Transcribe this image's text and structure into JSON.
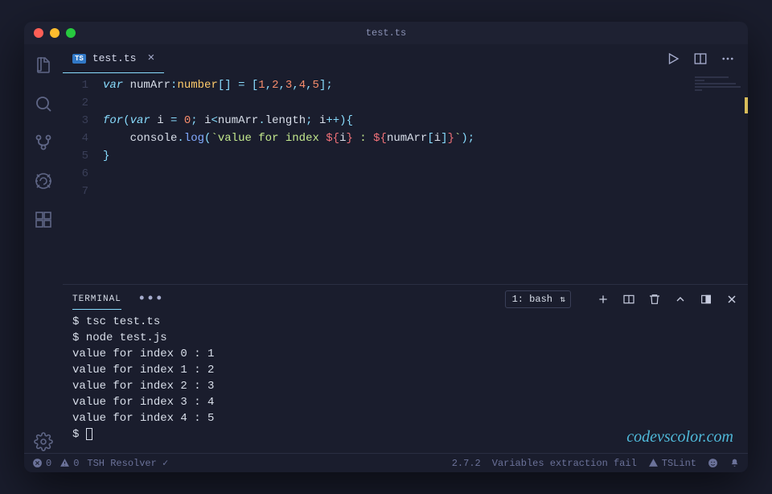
{
  "titlebar": {
    "title": "test.ts"
  },
  "tab": {
    "badge": "TS",
    "name": "test.ts",
    "close": "×"
  },
  "code": {
    "lines": [
      "1",
      "2",
      "3",
      "4",
      "5",
      "6",
      "7"
    ],
    "l1": {
      "var": "var ",
      "name": "numArr",
      "colon": ":",
      "type": "number",
      "brackets": "[] ",
      "eq": "= [",
      "n1": "1",
      "c1": ",",
      "n2": "2",
      "c2": ",",
      "n3": "3",
      "c3": ",",
      "n4": "4",
      "c4": ",",
      "n5": "5",
      "end": "];"
    },
    "l3": {
      "for": "for",
      "open": "(",
      "var": "var ",
      "i": "i",
      "eq": " = ",
      "zero": "0",
      "sc1": "; ",
      "cond_i": "i",
      "lt": "<",
      "arr": "numArr",
      "dot": ".",
      "len": "length",
      "sc2": "; ",
      "ipp": "i",
      "pp": "++",
      "close": "){"
    },
    "l4": {
      "indent": "    ",
      "console": "console",
      "dot": ".",
      "log": "log",
      "open": "(",
      "tick1": "`",
      "txt1": "value for index ",
      "d1": "${",
      "i": "i",
      "d1c": "}",
      "txt2": " : ",
      "d2": "${",
      "arr": "numArr",
      "b1": "[",
      "i2": "i",
      "b2": "]",
      "d2c": "}",
      "tick2": "`",
      "close": ");"
    },
    "l5": {
      "brace": "}"
    }
  },
  "panel": {
    "tab": "TERMINAL",
    "dots": "•••",
    "select": "1: bash"
  },
  "terminal": {
    "l1": "$ tsc test.ts",
    "l2": "$ node test.js",
    "l3": "value for index 0 : 1",
    "l4": "value for index 1 : 2",
    "l5": "value for index 2 : 3",
    "l6": "value for index 3 : 4",
    "l7": "value for index 4 : 5",
    "l8": "$ "
  },
  "statusbar": {
    "errors": "0",
    "warnings": "0",
    "resolver": "TSH Resolver ✓",
    "version": "2.7.2",
    "msg": "Variables extraction fail",
    "tslint": "TSLint"
  },
  "watermark": "codevscolor.com"
}
